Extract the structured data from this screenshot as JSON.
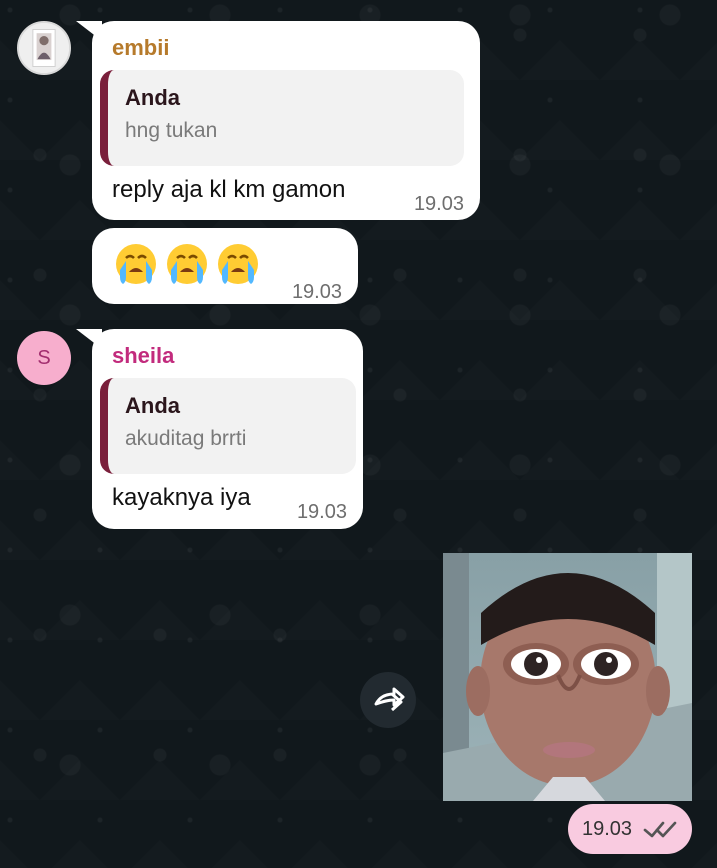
{
  "messages": {
    "embii": {
      "sender": "embii",
      "quote_author": "Anda",
      "quote_text": "hng tukan",
      "text": "reply aja kl km gamon",
      "time": "19.03"
    },
    "emoji": {
      "time": "19.03"
    },
    "sheila": {
      "avatar_initial": "S",
      "sender": "sheila",
      "quote_author": "Anda",
      "quote_text": "akuditag brrti",
      "text": "kayaknya iya",
      "time": "19.03"
    },
    "sent_media": {
      "time": "19.03"
    }
  },
  "icons": {
    "forward": "forward-icon",
    "read_receipt": "double-check-icon",
    "crying": "crying-face-icon"
  },
  "colors": {
    "wallpaper": "#11181c",
    "incoming_bubble": "#ffffff",
    "outgoing_meta": "#f9cbe0",
    "embii_name": "#b67a2b",
    "sheila_name": "#c22b7d",
    "quote_bar": "#7a1f3b",
    "quote_bg": "#f2f2f2"
  }
}
